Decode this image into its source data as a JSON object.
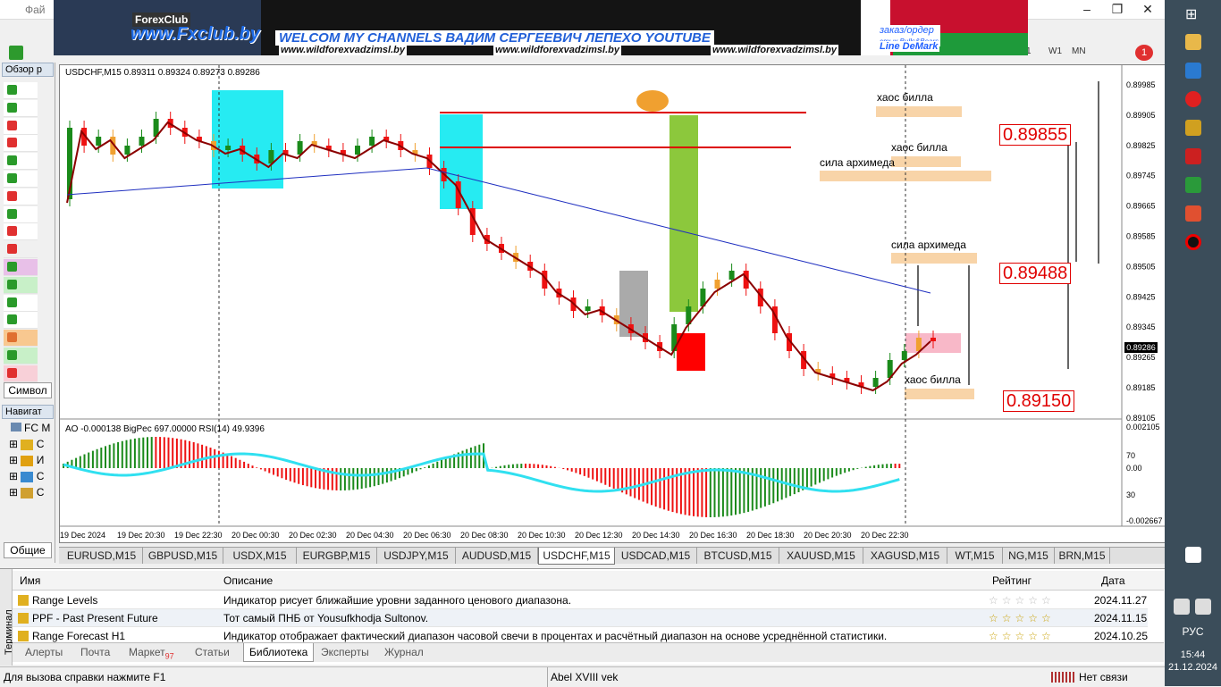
{
  "window": {
    "menu_label": "Фай"
  },
  "banner": {
    "logo": "ForexClub",
    "url": "www.Fxclub.by",
    "headline": "WELCOM MY CHANNELS ВАДИМ СЕРГЕЕВИЧ ЛЕПЕХО YOUTUBE",
    "site_links": [
      "www.wildforexvadzimsl.by",
      "www.wildforexvadzimsl.by",
      "www.wildforexvadzimsl.by"
    ],
    "order_text": "заказ/ордер",
    "order_sub": "стык Bulls&Bears",
    "demark_text": "Line DeMark"
  },
  "toolbar": {
    "timeframes": [
      "1",
      "W1",
      "MN"
    ]
  },
  "market_watch": {
    "title": "Обзор р",
    "tab_label": "Символ"
  },
  "navigator": {
    "title": "Навигат",
    "root": "FC M",
    "items": [
      "С",
      "И",
      "С",
      "С"
    ],
    "tab_label": "Общие"
  },
  "chart": {
    "header": "USDCHF,M15  0.89311 0.89324 0.89273 0.89286",
    "indicator_header": "AO -0.000138  BigPec 697.00000  RSI(14) 49.9396",
    "current_price": "0.89286",
    "price_ticks": [
      "0.89985",
      "0.89905",
      "0.89825",
      "0.89745",
      "0.89665",
      "0.89585",
      "0.89505",
      "0.89425",
      "0.89345",
      "0.89265",
      "0.89185",
      "0.89105"
    ],
    "indicator_ticks": [
      "0.002105",
      "70",
      "0.00",
      "30",
      "-0.002667"
    ],
    "time_ticks": [
      "19 Dec 2024",
      "19 Dec 20:30",
      "19 Dec 22:30",
      "20 Dec 00:30",
      "20 Dec 02:30",
      "20 Dec 04:30",
      "20 Dec 06:30",
      "20 Dec 08:30",
      "20 Dec 10:30",
      "20 Dec 12:30",
      "20 Dec 14:30",
      "20 Dec 16:30",
      "20 Dec 18:30",
      "20 Dec 20:30",
      "20 Dec 22:30"
    ],
    "price_levels": [
      "0.89855",
      "0.89488",
      "0.89150"
    ],
    "annotations": [
      "хаос билла",
      "хаос билла",
      "сила архимеда",
      "сила архимеда",
      "хаос билла"
    ],
    "colors": {
      "bull": "#1a8a1a",
      "bear": "#ee1111",
      "orange": "#f0a030",
      "ma_blue": "#2030c0",
      "ma_red": "#8b0000",
      "cyan": "#00e8f0",
      "green_zone": "#8cc83c"
    }
  },
  "symbol_tabs": [
    "EURUSD,M15",
    "GBPUSD,M15",
    "USDX,M15",
    "EURGBP,M15",
    "USDJPY,M15",
    "AUDUSD,M15",
    "USDCHF,M15",
    "USDCAD,M15",
    "BTCUSD,M15",
    "XAUUSD,M15",
    "XAGUSD,M15",
    "WT,M15",
    "NG,M15",
    "BRN,M15"
  ],
  "active_symbol_tab": "USDCHF,M15",
  "terminal": {
    "side_label": "Терминал",
    "columns": {
      "name": "Имя",
      "description": "Описание",
      "rating": "Рейтинг",
      "date": "Дата"
    },
    "rows": [
      {
        "name": "Range Levels",
        "description": "Индикатор рисует ближайшие уровни заданного ценового диапазона.",
        "date": "2024.11.27",
        "stars": 0
      },
      {
        "name": "PPF - Past Present Future",
        "description": "Тот самый ПНБ от Yousufkhodja Sultonov.",
        "date": "2024.11.15",
        "stars": 5
      },
      {
        "name": "Range Forecast H1",
        "description": "Индикатор отображает фактический диапазон часовой свечи в процентах и расчётный диапазон на основе усреднённой статистики.",
        "date": "2024.10.25",
        "stars": 5
      }
    ],
    "tabs": [
      "Алерты",
      "Почта",
      "Маркет",
      "Статьи",
      "Библиотека",
      "Эксперты",
      "Журнал"
    ],
    "market_badge": "97",
    "active_tab": "Библиотека"
  },
  "status": {
    "help": "Для вызова справки нажмите F1",
    "profile": "Abel XVIII vek",
    "connection": "Нет связи"
  },
  "taskbar": {
    "lang": "РУС",
    "time": "15:44",
    "date": "21.12.2024"
  }
}
